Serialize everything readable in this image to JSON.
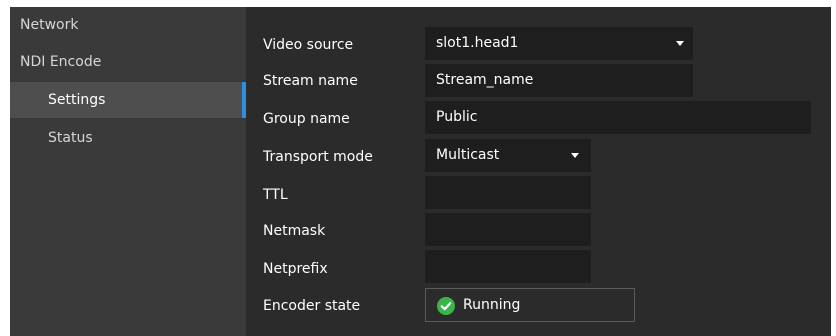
{
  "sidebar": {
    "items": [
      {
        "label": "Network"
      },
      {
        "label": "NDI Encode"
      },
      {
        "label": "Settings"
      },
      {
        "label": "Status"
      }
    ]
  },
  "form": {
    "video_source": {
      "label": "Video source",
      "value": "slot1.head1"
    },
    "stream_name": {
      "label": "Stream name",
      "value": "Stream_name"
    },
    "group_name": {
      "label": "Group name",
      "value": "Public"
    },
    "transport_mode": {
      "label": "Transport mode",
      "value": "Multicast"
    },
    "ttl": {
      "label": "TTL",
      "value": ""
    },
    "netmask": {
      "label": "Netmask",
      "value": ""
    },
    "netprefix": {
      "label": "Netprefix",
      "value": ""
    },
    "encoder_state": {
      "label": "Encoder state",
      "value": "Running"
    }
  },
  "colors": {
    "accent": "#2d8ee0",
    "success": "#3bb54a",
    "sidebar_bg": "#3a3a3a",
    "content_bg": "#2b2b2b",
    "field_bg": "#1e1e1e"
  },
  "icons": {
    "dropdown": "chevron-down-icon",
    "status": "check-circle-icon"
  }
}
